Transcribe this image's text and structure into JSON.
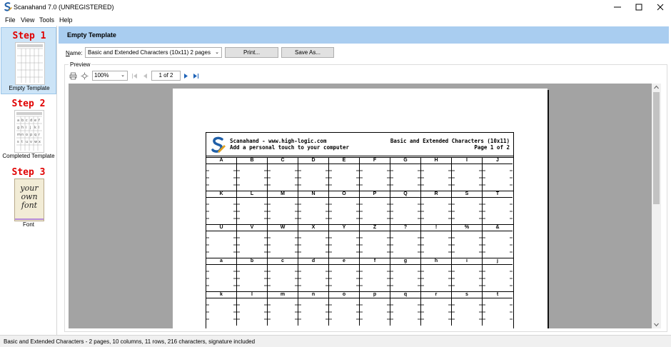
{
  "window": {
    "title": "Scanahand 7.0 (UNREGISTERED)",
    "controls": [
      "minimize-icon",
      "maximize-icon",
      "close-icon"
    ]
  },
  "menu": [
    "File",
    "View",
    "Tools",
    "Help"
  ],
  "steps": [
    {
      "heading": "Step 1",
      "label": "Empty Template",
      "selected": true
    },
    {
      "heading": "Step 2",
      "label": "Completed Template",
      "selected": false
    },
    {
      "heading": "Step 3",
      "label": "Font",
      "selected": false,
      "thumb_text": [
        "your",
        "own",
        "font"
      ]
    }
  ],
  "header": {
    "title": "Empty Template"
  },
  "name_field": {
    "label_prefix": "N",
    "label_rest": "ame:",
    "value": "Basic and Extended Characters (10x11) 2 pages"
  },
  "buttons": {
    "print": "Print...",
    "save_as": "Save As..."
  },
  "preview": {
    "legend": "Preview",
    "zoom": "100%",
    "page_indicator": "1 of 2"
  },
  "sheet": {
    "site": "Scanahand - www.high-logic.com",
    "tagline": "Add a personal touch to your computer",
    "set_name": "Basic and Extended Characters (10x11)",
    "page_label": "Page 1 of 2",
    "rows": [
      [
        "A",
        "B",
        "C",
        "D",
        "E",
        "F",
        "G",
        "H",
        "I",
        "J"
      ],
      [
        "K",
        "L",
        "M",
        "N",
        "O",
        "P",
        "Q",
        "R",
        "S",
        "T"
      ],
      [
        "U",
        "V",
        "W",
        "X",
        "Y",
        "Z",
        "?",
        "!",
        "%",
        "&"
      ],
      [
        "a",
        "b",
        "c",
        "d",
        "e",
        "f",
        "g",
        "h",
        "i",
        "j"
      ],
      [
        "k",
        "l",
        "m",
        "n",
        "o",
        "p",
        "q",
        "r",
        "s",
        "t"
      ]
    ]
  },
  "status": {
    "text": "Basic and Extended Characters - 2 pages, 10 columns, 11 rows, 216 characters, signature included"
  },
  "colors": {
    "header_bar": "#a9cdf0",
    "selected_step": "#cce4f7",
    "step_heading": "#e00000",
    "canvas": "#a3a3a3"
  }
}
